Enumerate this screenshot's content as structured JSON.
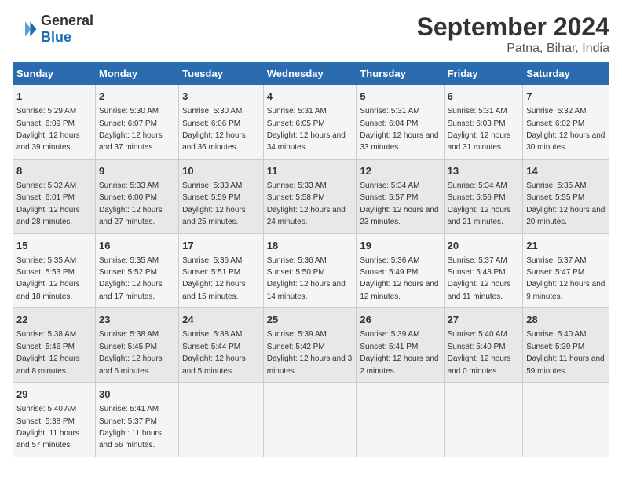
{
  "header": {
    "logo_general": "General",
    "logo_blue": "Blue",
    "main_title": "September 2024",
    "sub_title": "Patna, Bihar, India"
  },
  "days_of_week": [
    "Sunday",
    "Monday",
    "Tuesday",
    "Wednesday",
    "Thursday",
    "Friday",
    "Saturday"
  ],
  "weeks": [
    [
      {
        "day": "1",
        "sunrise": "5:29 AM",
        "sunset": "6:09 PM",
        "daylight": "12 hours and 39 minutes."
      },
      {
        "day": "2",
        "sunrise": "5:30 AM",
        "sunset": "6:07 PM",
        "daylight": "12 hours and 37 minutes."
      },
      {
        "day": "3",
        "sunrise": "5:30 AM",
        "sunset": "6:06 PM",
        "daylight": "12 hours and 36 minutes."
      },
      {
        "day": "4",
        "sunrise": "5:31 AM",
        "sunset": "6:05 PM",
        "daylight": "12 hours and 34 minutes."
      },
      {
        "day": "5",
        "sunrise": "5:31 AM",
        "sunset": "6:04 PM",
        "daylight": "12 hours and 33 minutes."
      },
      {
        "day": "6",
        "sunrise": "5:31 AM",
        "sunset": "6:03 PM",
        "daylight": "12 hours and 31 minutes."
      },
      {
        "day": "7",
        "sunrise": "5:32 AM",
        "sunset": "6:02 PM",
        "daylight": "12 hours and 30 minutes."
      }
    ],
    [
      {
        "day": "8",
        "sunrise": "5:32 AM",
        "sunset": "6:01 PM",
        "daylight": "12 hours and 28 minutes."
      },
      {
        "day": "9",
        "sunrise": "5:33 AM",
        "sunset": "6:00 PM",
        "daylight": "12 hours and 27 minutes."
      },
      {
        "day": "10",
        "sunrise": "5:33 AM",
        "sunset": "5:59 PM",
        "daylight": "12 hours and 25 minutes."
      },
      {
        "day": "11",
        "sunrise": "5:33 AM",
        "sunset": "5:58 PM",
        "daylight": "12 hours and 24 minutes."
      },
      {
        "day": "12",
        "sunrise": "5:34 AM",
        "sunset": "5:57 PM",
        "daylight": "12 hours and 23 minutes."
      },
      {
        "day": "13",
        "sunrise": "5:34 AM",
        "sunset": "5:56 PM",
        "daylight": "12 hours and 21 minutes."
      },
      {
        "day": "14",
        "sunrise": "5:35 AM",
        "sunset": "5:55 PM",
        "daylight": "12 hours and 20 minutes."
      }
    ],
    [
      {
        "day": "15",
        "sunrise": "5:35 AM",
        "sunset": "5:53 PM",
        "daylight": "12 hours and 18 minutes."
      },
      {
        "day": "16",
        "sunrise": "5:35 AM",
        "sunset": "5:52 PM",
        "daylight": "12 hours and 17 minutes."
      },
      {
        "day": "17",
        "sunrise": "5:36 AM",
        "sunset": "5:51 PM",
        "daylight": "12 hours and 15 minutes."
      },
      {
        "day": "18",
        "sunrise": "5:36 AM",
        "sunset": "5:50 PM",
        "daylight": "12 hours and 14 minutes."
      },
      {
        "day": "19",
        "sunrise": "5:36 AM",
        "sunset": "5:49 PM",
        "daylight": "12 hours and 12 minutes."
      },
      {
        "day": "20",
        "sunrise": "5:37 AM",
        "sunset": "5:48 PM",
        "daylight": "12 hours and 11 minutes."
      },
      {
        "day": "21",
        "sunrise": "5:37 AM",
        "sunset": "5:47 PM",
        "daylight": "12 hours and 9 minutes."
      }
    ],
    [
      {
        "day": "22",
        "sunrise": "5:38 AM",
        "sunset": "5:46 PM",
        "daylight": "12 hours and 8 minutes."
      },
      {
        "day": "23",
        "sunrise": "5:38 AM",
        "sunset": "5:45 PM",
        "daylight": "12 hours and 6 minutes."
      },
      {
        "day": "24",
        "sunrise": "5:38 AM",
        "sunset": "5:44 PM",
        "daylight": "12 hours and 5 minutes."
      },
      {
        "day": "25",
        "sunrise": "5:39 AM",
        "sunset": "5:42 PM",
        "daylight": "12 hours and 3 minutes."
      },
      {
        "day": "26",
        "sunrise": "5:39 AM",
        "sunset": "5:41 PM",
        "daylight": "12 hours and 2 minutes."
      },
      {
        "day": "27",
        "sunrise": "5:40 AM",
        "sunset": "5:40 PM",
        "daylight": "12 hours and 0 minutes."
      },
      {
        "day": "28",
        "sunrise": "5:40 AM",
        "sunset": "5:39 PM",
        "daylight": "11 hours and 59 minutes."
      }
    ],
    [
      {
        "day": "29",
        "sunrise": "5:40 AM",
        "sunset": "5:38 PM",
        "daylight": "11 hours and 57 minutes."
      },
      {
        "day": "30",
        "sunrise": "5:41 AM",
        "sunset": "5:37 PM",
        "daylight": "11 hours and 56 minutes."
      },
      null,
      null,
      null,
      null,
      null
    ]
  ],
  "labels": {
    "sunrise": "Sunrise: ",
    "sunset": "Sunset: ",
    "daylight": "Daylight: "
  }
}
